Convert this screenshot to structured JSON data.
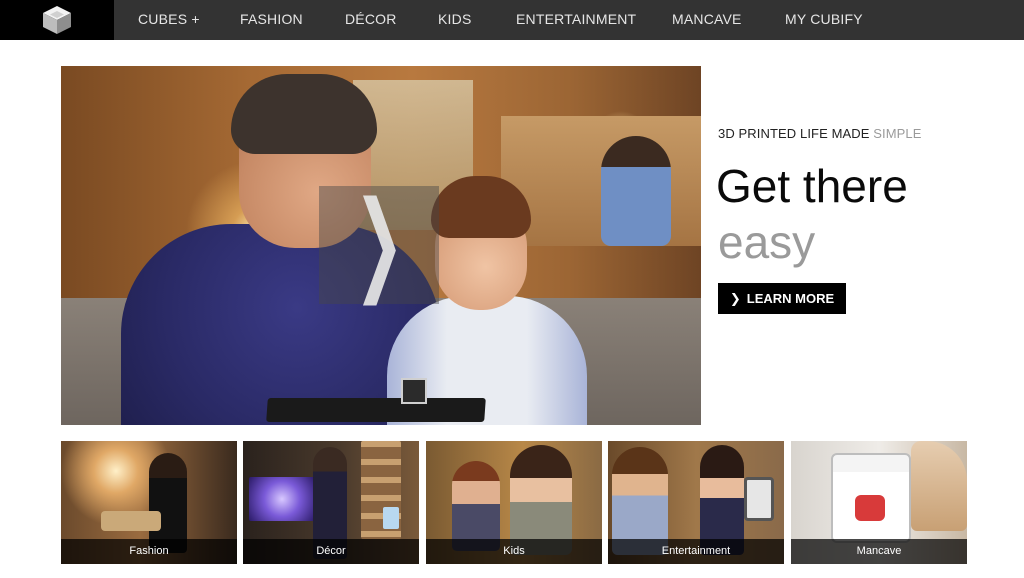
{
  "nav": {
    "logo": "cubify-cube-logo",
    "items": [
      {
        "label": "CUBES +"
      },
      {
        "label": "FASHION"
      },
      {
        "label": "DÉCOR"
      },
      {
        "label": "KIDS"
      },
      {
        "label": "ENTERTAINMENT"
      },
      {
        "label": "MANCAVE"
      },
      {
        "label": "MY CUBIFY"
      }
    ]
  },
  "hero": {
    "next_icon": "chevron-right-icon"
  },
  "promo": {
    "tagline_main": "3D PRINTED LIFE MADE ",
    "tagline_accent": "SIMPLE",
    "headline_line1": "Get there",
    "headline_line2": "easy",
    "cta_icon": "chevron-right-icon",
    "cta_label": "LEARN MORE"
  },
  "categories": [
    {
      "label": "Fashion"
    },
    {
      "label": "Décor"
    },
    {
      "label": "Kids"
    },
    {
      "label": "Entertainment"
    },
    {
      "label": "Mancave"
    }
  ],
  "colors": {
    "nav_bg": "#333333",
    "logo_bg": "#000000",
    "cta_bg": "#000000",
    "accent_grey": "#9a9a9a"
  }
}
